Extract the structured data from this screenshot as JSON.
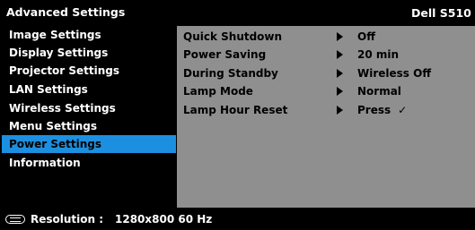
{
  "header": {
    "title": "Advanced Settings",
    "model": "Dell S510"
  },
  "sidebar": {
    "items": [
      {
        "label": "Image Settings"
      },
      {
        "label": "Display Settings"
      },
      {
        "label": "Projector Settings"
      },
      {
        "label": "LAN Settings"
      },
      {
        "label": "Wireless Settings"
      },
      {
        "label": "Menu Settings"
      },
      {
        "label": "Power Settings"
      },
      {
        "label": "Information"
      }
    ],
    "active": "Power Settings"
  },
  "panel": {
    "rows": [
      {
        "label": "Quick Shutdown",
        "value": "Off"
      },
      {
        "label": "Power Saving",
        "value": "20  min"
      },
      {
        "label": "During Standby",
        "value": "Wireless Off"
      },
      {
        "label": "Lamp Mode",
        "value": "Normal"
      },
      {
        "label": "Lamp Hour Reset",
        "value": "Press",
        "check": "✓"
      }
    ]
  },
  "status": {
    "label": "Resolution :",
    "value": "1280x800 60 Hz"
  },
  "colors": {
    "accent": "#1d8fe0",
    "panel": "#8f8f8f",
    "background": "#000000"
  }
}
